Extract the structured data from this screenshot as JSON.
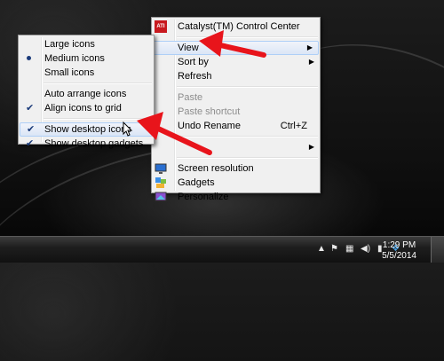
{
  "context_menu": {
    "items": [
      {
        "label": "Catalyst(TM) Control Center",
        "icon": "ati-icon"
      },
      {
        "label": "View",
        "submenu": true
      },
      {
        "label": "Sort by",
        "submenu": true
      },
      {
        "label": "Refresh"
      },
      {
        "label": "Paste",
        "disabled": true
      },
      {
        "label": "Paste shortcut",
        "disabled": true
      },
      {
        "label": "Undo Rename",
        "shortcut": "Ctrl+Z"
      },
      {
        "label": "",
        "submenu": true
      },
      {
        "label": "Screen resolution",
        "icon": "screen-resolution-icon"
      },
      {
        "label": "Gadgets",
        "icon": "gadgets-icon"
      },
      {
        "label": "Personalize",
        "icon": "personalize-icon"
      }
    ]
  },
  "view_submenu": {
    "items": [
      {
        "label": "Large icons"
      },
      {
        "label": "Medium icons",
        "selected": true
      },
      {
        "label": "Small icons"
      },
      {
        "label": "Auto arrange icons"
      },
      {
        "label": "Align icons to grid",
        "checked": true
      },
      {
        "label": "Show desktop icons",
        "checked": true
      },
      {
        "label": "Show desktop gadgets",
        "checked": true
      }
    ]
  },
  "taskbar": {
    "time": "1:29 PM",
    "date": "5/5/2014"
  },
  "colors": {
    "arrow": "#e8141b",
    "check": "#1b3b7a",
    "hover_border": "#aecff7"
  }
}
